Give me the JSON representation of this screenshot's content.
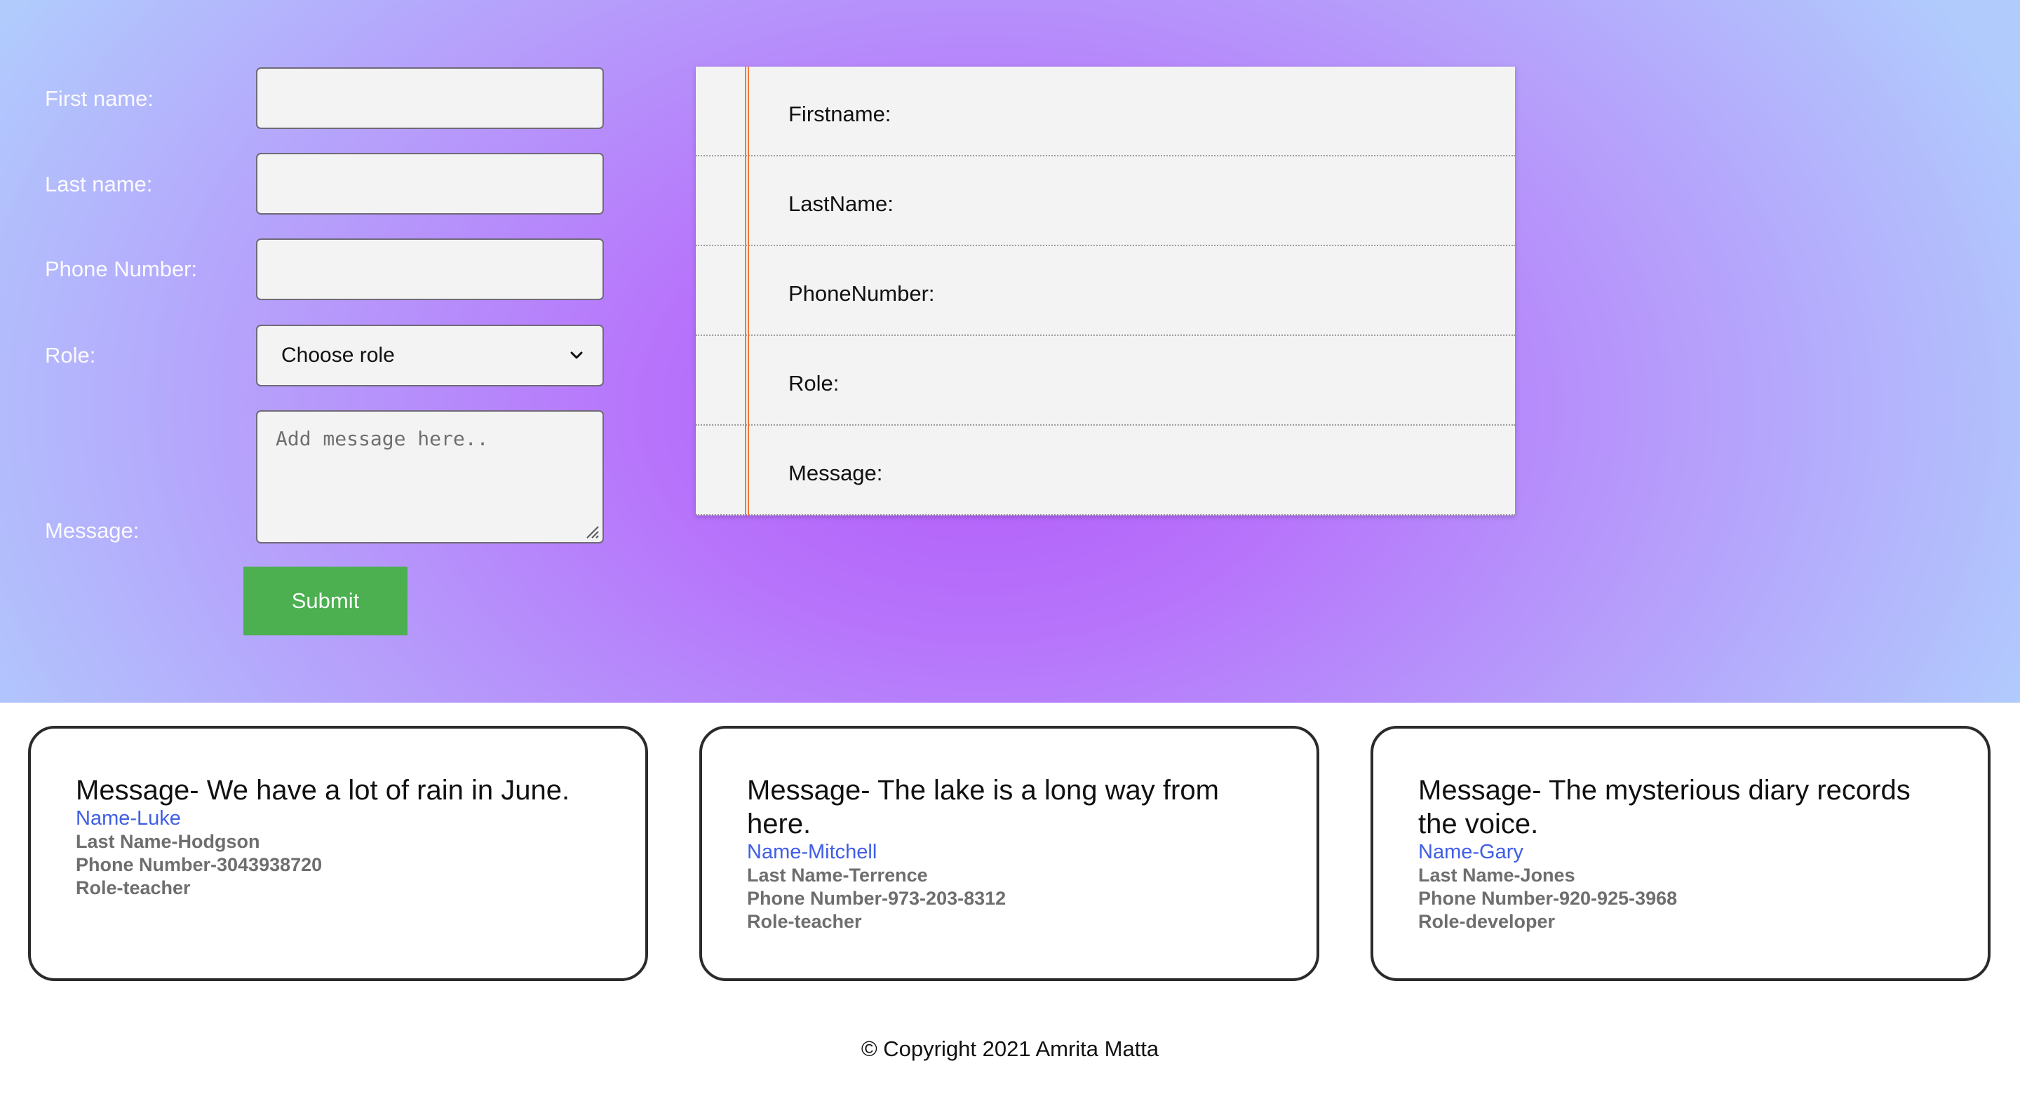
{
  "form": {
    "first_name_label": "First name:",
    "last_name_label": "Last name:",
    "phone_label": "Phone Number:",
    "role_label": "Role:",
    "message_label": "Message:",
    "first_name_value": "",
    "last_name_value": "",
    "phone_value": "",
    "role_selected": "Choose role",
    "message_placeholder": "Add message here..",
    "submit_label": "Submit"
  },
  "preview": {
    "firstname_label": "Firstname:",
    "lastname_label": "LastName:",
    "phone_label": "PhoneNumber:",
    "role_label": "Role:",
    "message_label": "Message:"
  },
  "cards": [
    {
      "message": "Message- We have a lot of rain in June.",
      "name": "Name-Luke",
      "last_name": "Last Name-Hodgson",
      "phone": "Phone Number-3043938720",
      "role": "Role-teacher"
    },
    {
      "message": "Message- The lake is a long way from here.",
      "name": "Name-Mitchell",
      "last_name": "Last Name-Terrence",
      "phone": "Phone Number-973-203-8312",
      "role": "Role-teacher"
    },
    {
      "message": "Message- The mysterious diary records the voice.",
      "name": "Name-Gary",
      "last_name": "Last Name-Jones",
      "phone": "Phone Number-920-925-3968",
      "role": "Role-developer"
    }
  ],
  "footer": {
    "copyright": "© Copyright 2021 Amrita Matta"
  },
  "colors": {
    "hero_center": "#b25af8",
    "hero_edge": "#b1cbfd",
    "submit": "#4caf50",
    "name_link": "#3f5ee6",
    "notepad_margin": "#f07a3a"
  }
}
